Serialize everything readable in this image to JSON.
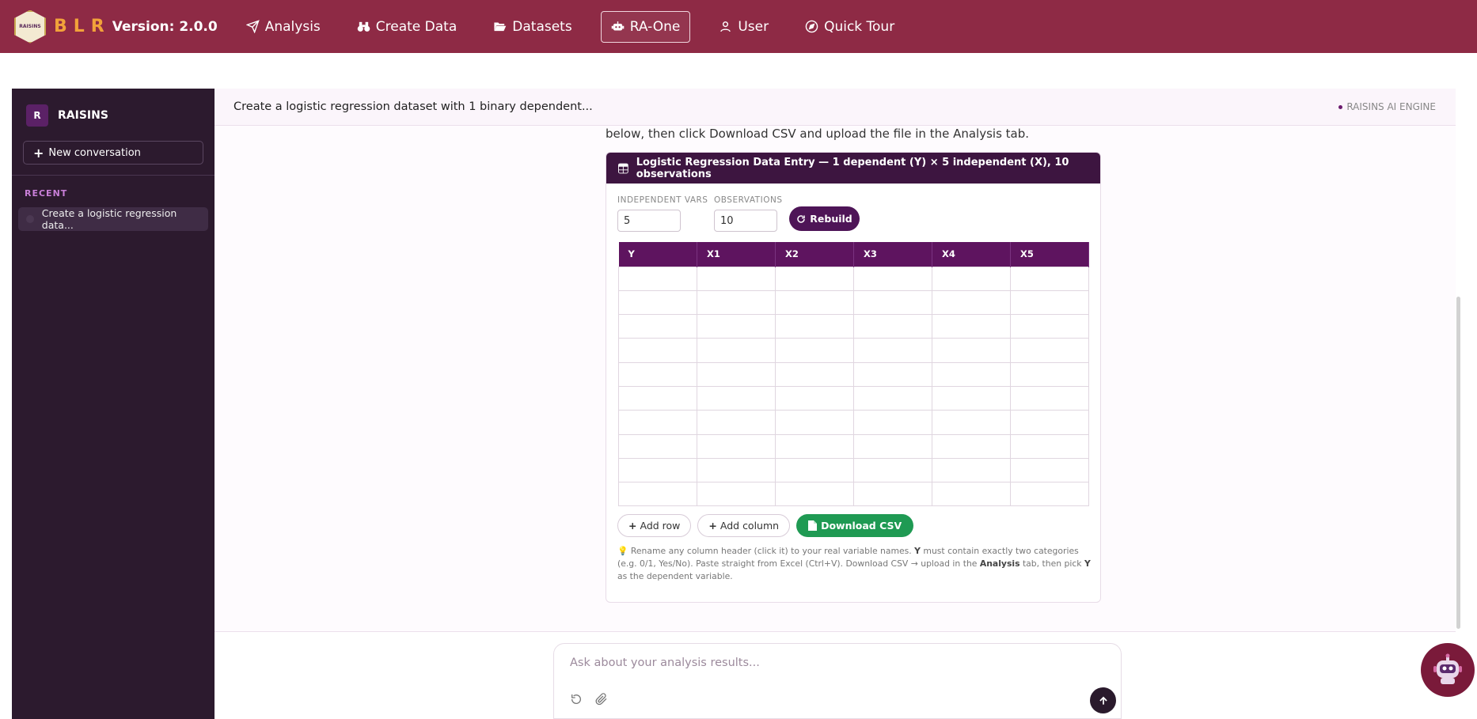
{
  "nav": {
    "logo_small_text": "RAISINS",
    "logo_letters": "BLR",
    "version": "Version: 2.0.0",
    "items": [
      {
        "label": "Analysis",
        "icon": "paper-plane-icon"
      },
      {
        "label": "Create Data",
        "icon": "binoculars-icon"
      },
      {
        "label": "Datasets",
        "icon": "folder-open-icon"
      },
      {
        "label": "RA-One",
        "icon": "robot-icon",
        "active": true
      },
      {
        "label": "User",
        "icon": "user-icon"
      },
      {
        "label": "Quick Tour",
        "icon": "compass-icon"
      }
    ],
    "bg_color": "#8e2a45"
  },
  "sidebar": {
    "badge": "R",
    "brand": "RAISINS",
    "new_conversation": "New conversation",
    "recent_label": "RECENT",
    "recent_items": [
      "Create a logistic regression data..."
    ]
  },
  "chat": {
    "title": "Create a logistic regression dataset with 1 binary dependent...",
    "engine": "RAISINS AI ENGINE",
    "intro_text": "below, then click Download CSV and upload the file in the Analysis tab."
  },
  "card": {
    "title": "Logistic Regression Data Entry — 1 dependent (Y) × 5 independent (X), 10 observations",
    "independent_vars_label": "INDEPENDENT VARS",
    "independent_vars_value": "5",
    "observations_label": "OBSERVATIONS",
    "observations_value": "10",
    "rebuild_label": "Rebuild",
    "columns": [
      "Y",
      "X1",
      "X2",
      "X3",
      "X4",
      "X5"
    ],
    "row_count": 10,
    "add_row": "Add row",
    "add_column": "Add column",
    "download_csv": "Download CSV",
    "hint_parts": {
      "a": "Rename any column header (click it) to your real variable names.",
      "b": "Y",
      "c": "must contain exactly two categories (e.g. 0/1, Yes/No). Paste straight from Excel (Ctrl+V). Download CSV → upload in the",
      "d": "Analysis",
      "e": "tab, then pick",
      "f": "Y",
      "g": "as the dependent variable."
    },
    "header_color": "#3d1540",
    "column_header_color": "#5e145f",
    "download_color": "#1f9a53"
  },
  "composer": {
    "placeholder": "Ask about your analysis results..."
  }
}
